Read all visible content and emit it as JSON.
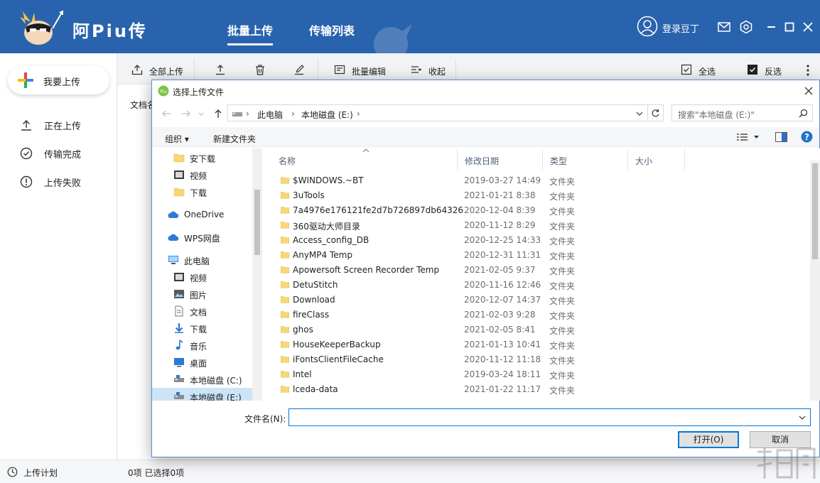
{
  "header": {
    "app_title": "阿Piu传",
    "tabs": [
      {
        "label": "批量上传",
        "active": true
      },
      {
        "label": "传输列表",
        "active": false
      }
    ],
    "login_label": "登录豆丁",
    "accent": "#2a63ad"
  },
  "sidebar": {
    "upload_label": "我要上传",
    "items": [
      {
        "label": "正在上传",
        "icon": "upload-arrow-icon"
      },
      {
        "label": "传输完成",
        "icon": "check-circle-icon"
      },
      {
        "label": "上传失败",
        "icon": "warning-circle-icon"
      }
    ],
    "footer_label": "上传计划"
  },
  "toolbar": {
    "upload_all": "全部上传",
    "batch_edit": "批量编辑",
    "collapse": "收起",
    "select_all": "全选",
    "invert": "反选"
  },
  "main": {
    "column_header": "文档名",
    "status": "0项 已选择0项"
  },
  "dialog": {
    "title": "选择上传文件",
    "breadcrumb": [
      "此电脑",
      "本地磁盘 (E:)"
    ],
    "search_placeholder": "搜索\"本地磁盘 (E:)\"",
    "organize": "组织 ▾",
    "new_folder": "新建文件夹",
    "nav": [
      {
        "label": "安下载",
        "icon": "folder-icon"
      },
      {
        "label": "视频",
        "icon": "video-icon"
      },
      {
        "label": "下载",
        "icon": "folder-icon"
      },
      {
        "label": "OneDrive",
        "icon": "cloud-icon"
      },
      {
        "label": "WPS网盘",
        "icon": "cloud-icon"
      },
      {
        "label": "此电脑",
        "icon": "computer-icon"
      },
      {
        "label": "视频",
        "icon": "video-icon"
      },
      {
        "label": "图片",
        "icon": "picture-icon"
      },
      {
        "label": "文档",
        "icon": "document-icon"
      },
      {
        "label": "下载",
        "icon": "download-icon"
      },
      {
        "label": "音乐",
        "icon": "music-icon"
      },
      {
        "label": "桌面",
        "icon": "desktop-icon"
      },
      {
        "label": "本地磁盘 (C:)",
        "icon": "drive-icon"
      },
      {
        "label": "本地磁盘 (E:)",
        "icon": "drive-icon",
        "selected": true
      }
    ],
    "columns": [
      "名称",
      "修改日期",
      "类型",
      "大小"
    ],
    "files": [
      {
        "name": "$WINDOWS.~BT",
        "date": "2019-03-27 14:49",
        "type": "文件夹"
      },
      {
        "name": "3uTools",
        "date": "2021-01-21 8:38",
        "type": "文件夹"
      },
      {
        "name": "7a4976e176121fe2d7b726897db64326",
        "date": "2020-12-04 8:39",
        "type": "文件夹"
      },
      {
        "name": "360驱动大师目录",
        "date": "2020-11-12 8:29",
        "type": "文件夹"
      },
      {
        "name": "Access_config_DB",
        "date": "2020-12-25 14:33",
        "type": "文件夹"
      },
      {
        "name": "AnyMP4 Temp",
        "date": "2020-12-31 11:31",
        "type": "文件夹"
      },
      {
        "name": "Apowersoft Screen Recorder Temp",
        "date": "2021-02-05 9:37",
        "type": "文件夹"
      },
      {
        "name": "DetuStitch",
        "date": "2020-11-16 12:46",
        "type": "文件夹"
      },
      {
        "name": "Download",
        "date": "2020-12-07 14:37",
        "type": "文件夹"
      },
      {
        "name": "fireClass",
        "date": "2021-02-03 9:28",
        "type": "文件夹"
      },
      {
        "name": "ghos",
        "date": "2021-02-05 8:41",
        "type": "文件夹"
      },
      {
        "name": "HouseKeeperBackup",
        "date": "2021-01-13 10:41",
        "type": "文件夹"
      },
      {
        "name": "iFontsClientFileCache",
        "date": "2020-11-12 11:18",
        "type": "文件夹"
      },
      {
        "name": "Intel",
        "date": "2019-03-24 18:11",
        "type": "文件夹"
      },
      {
        "name": "lceda-data",
        "date": "2021-01-22 11:17",
        "type": "文件夹"
      }
    ],
    "filename_label": "文件名(N):",
    "filename_value": "",
    "open_label": "打开(O)",
    "cancel_label": "取消"
  }
}
